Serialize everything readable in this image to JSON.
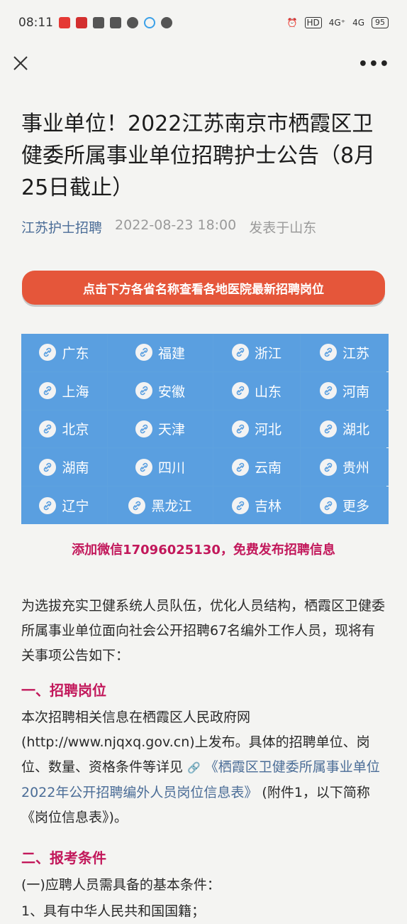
{
  "status_bar": {
    "time": "08:11",
    "network_a": "HD",
    "network_b": "4G⁺",
    "network_c": "4G",
    "battery": "95"
  },
  "nav": {
    "close_symbol": "×",
    "more_symbol": "•••"
  },
  "article": {
    "title": "事业单位！2022江苏南京市栖霞区卫健委所属事业单位招聘护士公告（8月25日截止）",
    "account": "江苏护士招聘",
    "datetime": "2022-08-23 18:00",
    "location": "发表于山东",
    "banner": "点击下方各省名称查看各地医院最新招聘岗位",
    "provinces": [
      "广东",
      "福建",
      "浙江",
      "江苏",
      "上海",
      "安徽",
      "山东",
      "河南",
      "北京",
      "天津",
      "河北",
      "湖北",
      "湖南",
      "四川",
      "云南",
      "贵州",
      "辽宁",
      "黑龙江",
      "吉林",
      "更多"
    ],
    "wechat": "添加微信17096025130，免费发布招聘信息",
    "intro": "为选拔充实卫健系统人员队伍，优化人员结构，栖霞区卫健委所属事业单位面向社会公开招聘67名编外工作人员，现将有关事项公告如下：",
    "section1": "一、招聘岗位",
    "body1_a": "本次招聘相关信息在栖霞区人民政府网(http://www.njqxq.gov.cn)上发布。具体的招聘单位、岗位、数量、资格条件等详见",
    "body1_link": "《栖霞区卫健委所属事业单位2022年公开招聘编外人员岗位信息表》",
    "body1_b": "(附件1，以下简称《岗位信息表》)。",
    "section2": "二、报考条件",
    "body2": "(一)应聘人员需具备的基本条件：",
    "body3": "1、具有中华人民共和国国籍；"
  },
  "colors": {
    "banner": "#e5563a",
    "grid": "#5a9fe0",
    "heading": "#c2185b",
    "link": "#4b6d97"
  }
}
